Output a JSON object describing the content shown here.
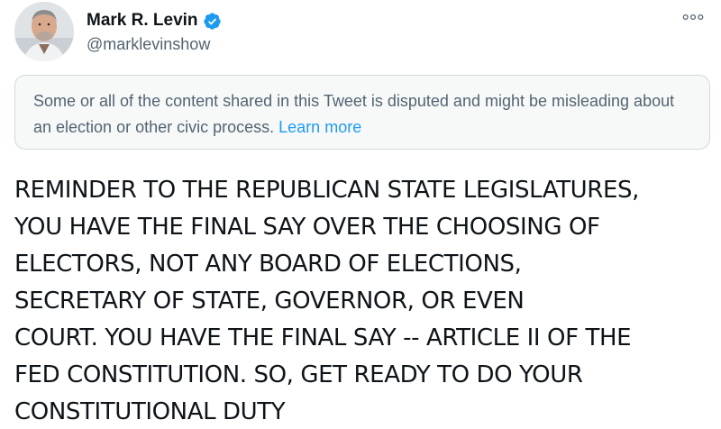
{
  "author": {
    "display_name": "Mark R. Levin",
    "handle": "@marklevinshow",
    "verified": true,
    "avatar_icon": "profile-photo"
  },
  "notice": {
    "text": "Some or all of the content shared in this Tweet is disputed and might be misleading about an election or other civic process.",
    "link_label": "Learn more"
  },
  "tweet": {
    "text": "REMINDER TO THE REPUBLICAN STATE LEGISLATURES,\nYOU HAVE THE FINAL SAY OVER THE CHOOSING OF\nELECTORS, NOT ANY BOARD OF ELECTIONS,\nSECRETARY OF STATE, GOVERNOR, OR EVEN\nCOURT. YOU HAVE THE FINAL SAY -- ARTICLE II OF THE\nFED CONSTITUTION. SO, GET READY TO DO YOUR\nCONSTITUTIONAL DUTY"
  },
  "colors": {
    "link": "#1d9bf0",
    "verified_badge": "#1d9bf0",
    "secondary_text": "#536471",
    "notice_bg": "#f7f9f9",
    "notice_border": "#cfd9de"
  },
  "icons": {
    "verified": "verified-badge-icon",
    "more": "more-options-icon"
  }
}
